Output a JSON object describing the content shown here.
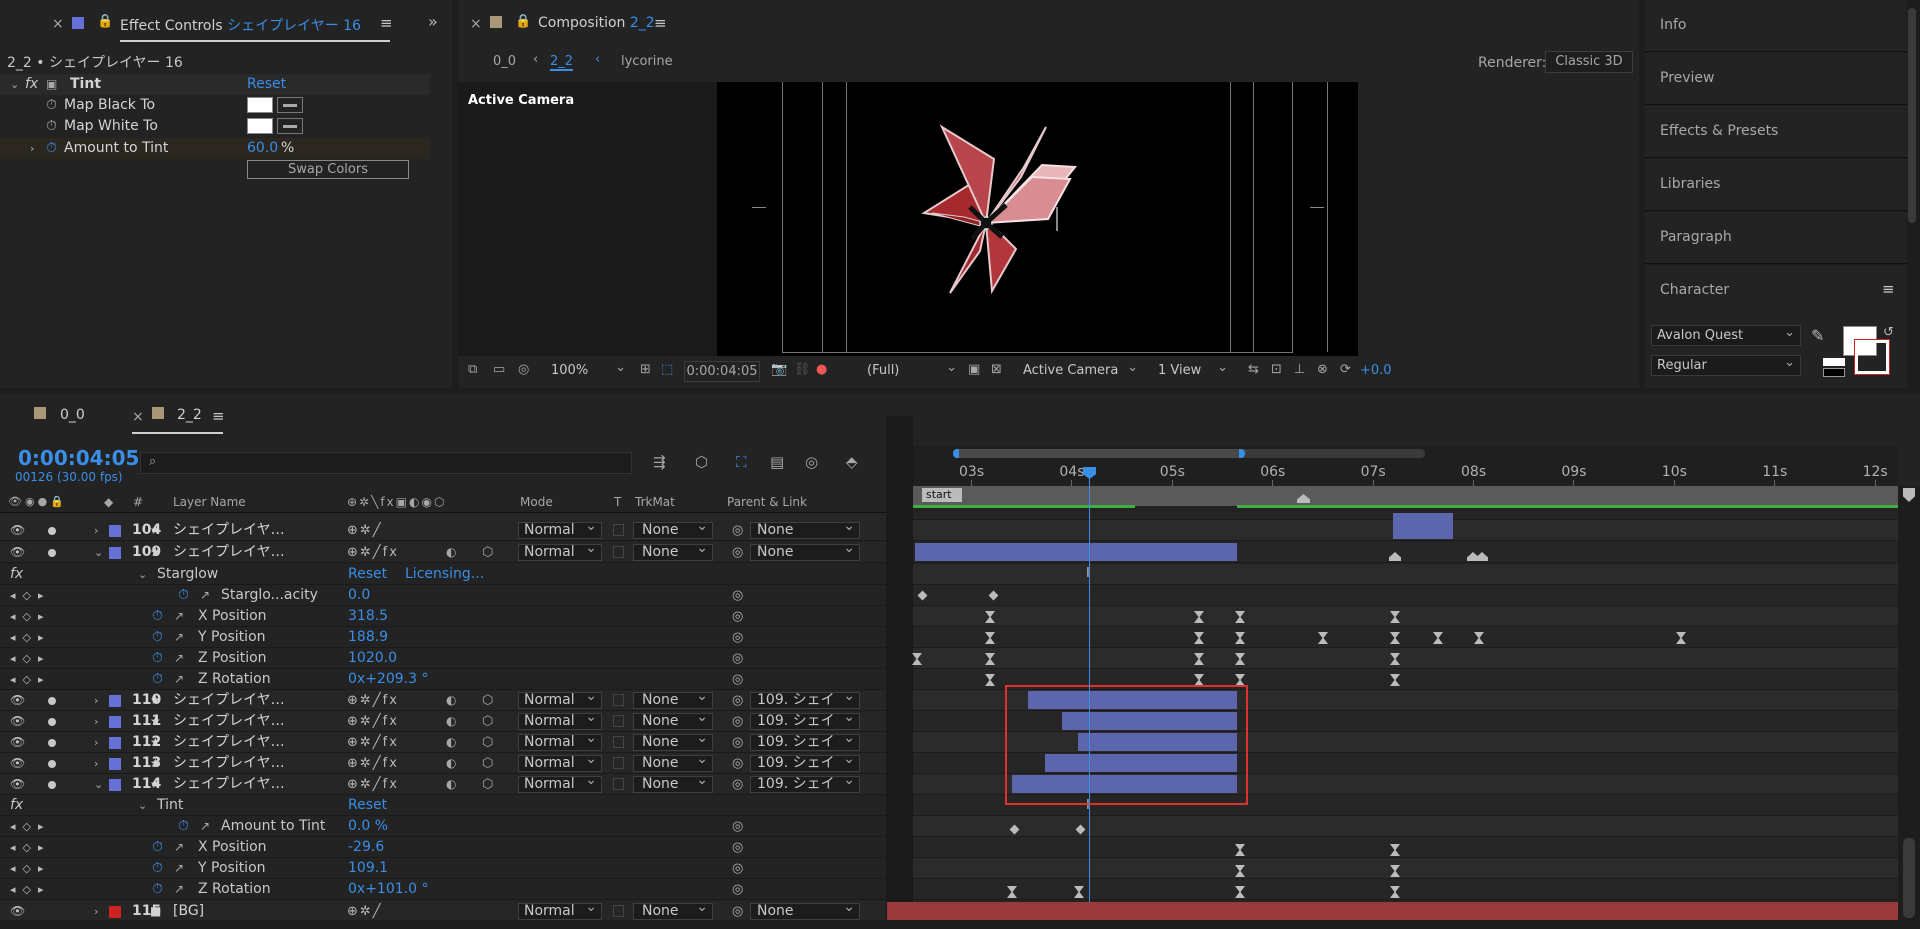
{
  "effect_controls": {
    "tab_title": "Effect Controls",
    "layer_name": "シェイプレイヤー 16",
    "breadcrumb": "2_2 • シェイプレイヤー 16",
    "effect_name": "Tint",
    "reset": "Reset",
    "props": [
      {
        "name": "Map Black To",
        "kind": "color"
      },
      {
        "name": "Map White To",
        "kind": "color"
      },
      {
        "name": "Amount to Tint",
        "value": "60.0",
        "unit": "%"
      }
    ],
    "swap_button": "Swap Colors"
  },
  "composition": {
    "tab_label": "Composition",
    "tab_name": "2_2",
    "crumbs": [
      "0_0",
      "2_2",
      "lycorine"
    ],
    "renderer_label": "Renderer:",
    "renderer_value": "Classic 3D",
    "camera_label": "Active Camera",
    "zoom": "100%",
    "timecode": "0:00:04:05",
    "resolution": "(Full)",
    "camera_select": "Active Camera",
    "view_select": "1 View",
    "exposure": "+0.0"
  },
  "right_panel": {
    "sections": [
      "Info",
      "Preview",
      "Effects & Presets",
      "Libraries",
      "Paragraph",
      "Character"
    ],
    "font_family": "Avalon Quest",
    "font_style": "Regular"
  },
  "timeline": {
    "tabs": [
      "0_0",
      "2_2"
    ],
    "timecode": "0:00:04:05",
    "frame_info": "00126 (30.00 fps)",
    "search_placeholder": "",
    "headers": {
      "layer_name": "Layer Name",
      "mode": "Mode",
      "t": "T",
      "trkmat": "TrkMat",
      "parent": "Parent & Link",
      "num": "#"
    },
    "ruler": [
      "03s",
      "04s",
      "05s",
      "06s",
      "07s",
      "08s",
      "09s",
      "10s",
      "11s",
      "12s"
    ],
    "marker": "start",
    "layers": [
      {
        "num": "104",
        "name": "シェイプレイヤ…",
        "mode": "Normal",
        "trkmat": "None",
        "parent": "None"
      },
      {
        "num": "109",
        "name": "シェイプレイヤ…",
        "mode": "Normal",
        "trkmat": "None",
        "parent": "None"
      },
      {
        "num": "110",
        "name": "シェイプレイヤ…",
        "mode": "Normal",
        "trkmat": "None",
        "parent": "109. シェイ"
      },
      {
        "num": "111",
        "name": "シェイプレイヤ…",
        "mode": "Normal",
        "trkmat": "None",
        "parent": "109. シェイ"
      },
      {
        "num": "112",
        "name": "シェイプレイヤ…",
        "mode": "Normal",
        "trkmat": "None",
        "parent": "109. シェイ"
      },
      {
        "num": "113",
        "name": "シェイプレイヤ…",
        "mode": "Normal",
        "trkmat": "None",
        "parent": "109. シェイ"
      },
      {
        "num": "114",
        "name": "シェイプレイヤ…",
        "mode": "Normal",
        "trkmat": "None",
        "parent": "109. シェイ"
      },
      {
        "num": "115",
        "name": "[BG]",
        "mode": "Normal",
        "trkmat": "None",
        "parent": "None"
      }
    ],
    "fx109": {
      "effect": "Starglow",
      "reset": "Reset",
      "licensing": "Licensing...",
      "props": [
        {
          "name": "Starglo...acity",
          "value": "0.0"
        },
        {
          "name": "X Position",
          "value": "318.5"
        },
        {
          "name": "Y Position",
          "value": "188.9"
        },
        {
          "name": "Z Position",
          "value": "1020.0"
        },
        {
          "name": "Z Rotation",
          "value": "0x+209.3 °"
        }
      ]
    },
    "fx114": {
      "effect": "Tint",
      "reset": "Reset",
      "props": [
        {
          "name": "Amount to Tint",
          "value": "0.0 %"
        },
        {
          "name": "X Position",
          "value": "-29.6"
        },
        {
          "name": "Y Position",
          "value": "109.1"
        },
        {
          "name": "Z Rotation",
          "value": "0x+101.0 °"
        }
      ]
    }
  }
}
